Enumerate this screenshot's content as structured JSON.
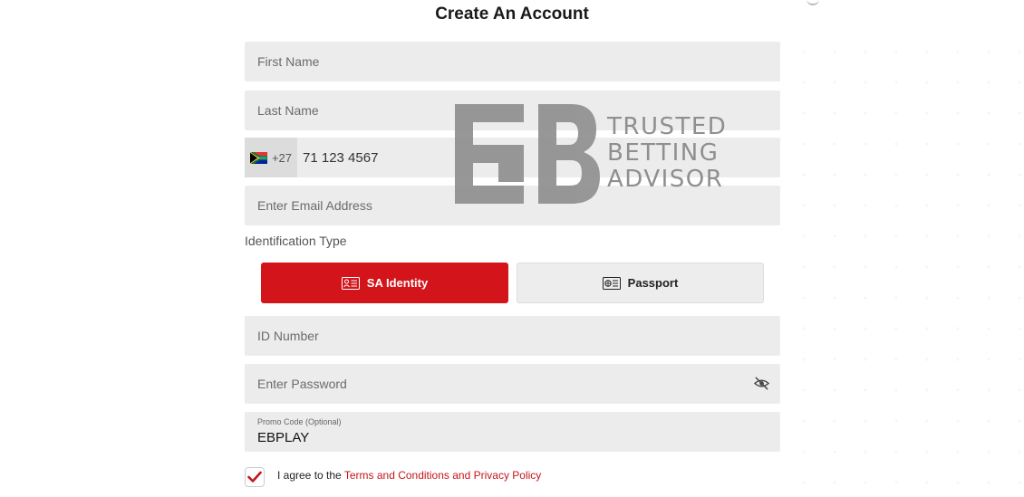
{
  "page": {
    "title": "Create An Account"
  },
  "form": {
    "first_name": {
      "placeholder": "First Name"
    },
    "last_name": {
      "placeholder": "Last Name"
    },
    "phone": {
      "country_code": "+27",
      "value": "71 123 4567",
      "flag": "south-africa-flag"
    },
    "email": {
      "placeholder": "Enter Email Address"
    },
    "identification": {
      "label": "Identification Type",
      "options": [
        {
          "label": "SA Identity",
          "icon": "id-card-icon",
          "selected": true
        },
        {
          "label": "Passport",
          "icon": "passport-icon",
          "selected": false
        }
      ]
    },
    "id_number": {
      "placeholder": "ID Number"
    },
    "password": {
      "placeholder": "Enter Password",
      "toggle_icon": "eye-slash-icon"
    },
    "promo": {
      "label": "Promo Code (Optional)",
      "value": "EBPLAY"
    },
    "terms": {
      "checked": true,
      "prefix": "I agree to the",
      "link1": "Terms and Conditions",
      "middle": "and",
      "link2": "Privacy Policy"
    }
  },
  "watermark": {
    "line1": "TRUSTED",
    "line2": "BETTING",
    "line3": "ADVISOR"
  },
  "colors": {
    "accent": "#d3141b",
    "field_bg": "#ececec",
    "link": "#c4161c"
  }
}
